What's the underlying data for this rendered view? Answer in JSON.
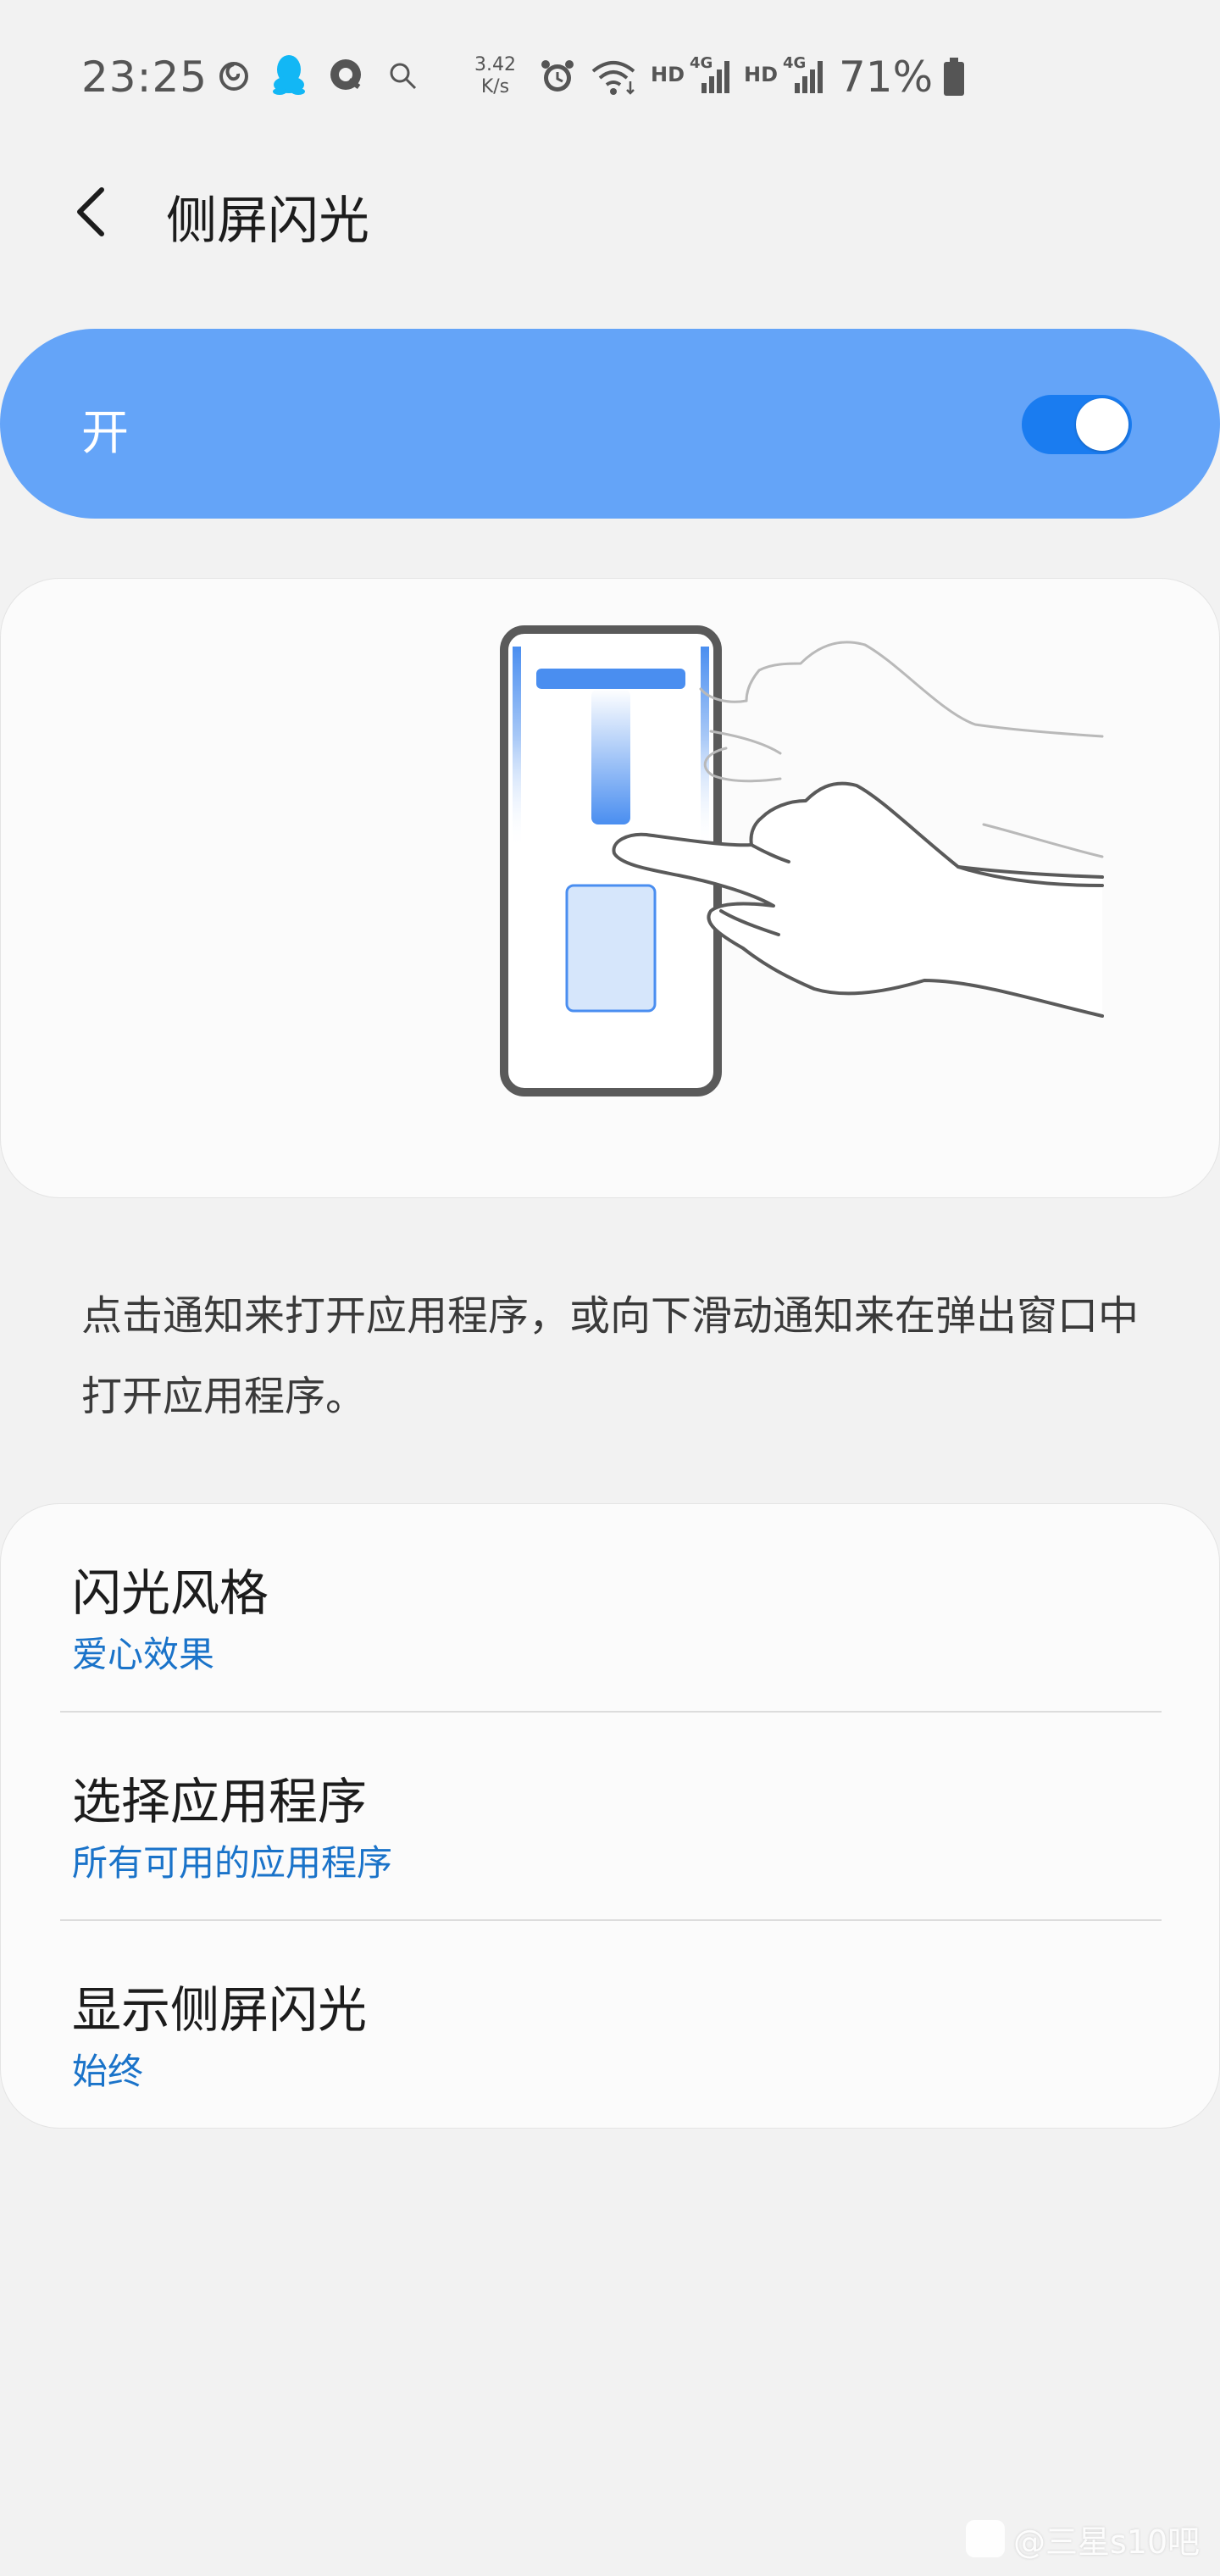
{
  "status_bar": {
    "time": "23:25",
    "speed_value": "3.42",
    "speed_unit": "K/s",
    "hd_1": "HD",
    "hd_2": "HD",
    "net_1": "4G",
    "net_2": "4G",
    "battery": "71%",
    "icons": [
      "netease-music-icon",
      "qq-icon",
      "q-app-icon",
      "search-icon",
      "alarm-icon",
      "wifi-icon",
      "signal-icon",
      "battery-icon"
    ]
  },
  "header": {
    "title": "侧屏闪光"
  },
  "master_switch": {
    "label": "开",
    "on": true
  },
  "description": "点击通知来打开应用程序，或向下滑动通知来在弹出窗口中打开应用程序。",
  "options": [
    {
      "title": "闪光风格",
      "value": "爱心效果"
    },
    {
      "title": "选择应用程序",
      "value": "所有可用的应用程序"
    },
    {
      "title": "显示侧屏闪光",
      "value": "始终"
    }
  ],
  "watermark": "@三星s10吧",
  "colors": {
    "switch_bar": "#64a4f8",
    "toggle_on": "#1a7cf0",
    "accent_text": "#1a73c9",
    "background": "#f2f2f2"
  }
}
